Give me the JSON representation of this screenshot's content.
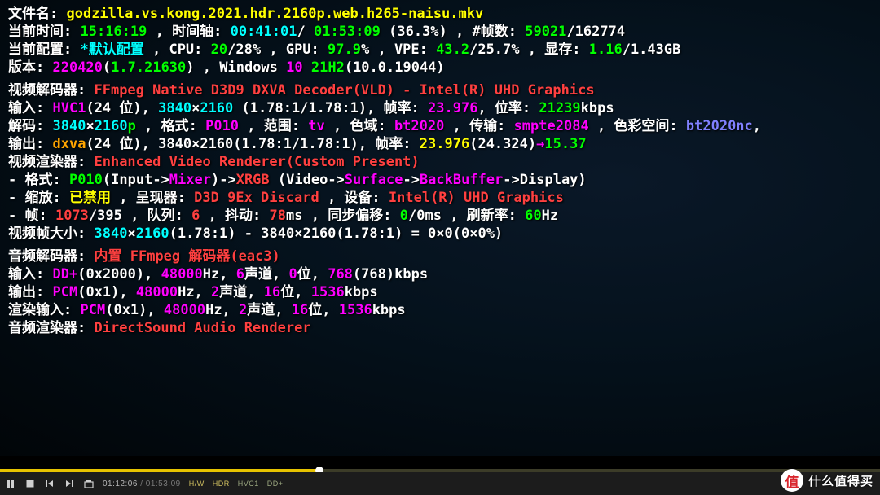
{
  "file": {
    "label": "文件名: ",
    "name": "godzilla.vs.kong.2021.hdr.2160p.web.h265-naisu.mkv"
  },
  "time": {
    "label_now": "当前时间: ",
    "now": "15:16:19",
    "sep1": ", ",
    "label_tl": "时间轴: ",
    "pos": "00:41:01",
    "dur": "01:53:09",
    "pct": "(36.3%)",
    "sep2": ", ",
    "label_frames": "#帧数: ",
    "fcur": "59021",
    "ftot": "162774"
  },
  "cfg": {
    "label": "当前配置: ",
    "name": "*默认配置",
    "cpu_l": ", CPU: ",
    "cpu_a": "20",
    "cpu_b": "28",
    "cpu_u": "%",
    "gpu_l": ", GPU: ",
    "gpu": "97.9",
    "gpu_u": "%",
    "vpe_l": ", VPE: ",
    "vpe_a": "43.2",
    "vpe_b": "25.7",
    "vpe_u": "%",
    "vram_l": ", 显存: ",
    "vram_a": "1.16",
    "vram_b": "1.43",
    "vram_u": "GB"
  },
  "ver": {
    "label": "版本: ",
    "date": "220420",
    "p1": "(",
    "v": "1.7.21630",
    "p2": ")",
    "os": ", Windows ",
    "osv": "10 ",
    "rel": "21H2",
    "p3": "(",
    "build": "10.0.19044",
    "p4": ")"
  },
  "vdec": {
    "label": "视频解码器: ",
    "name": "FFmpeg Native D3D9 DXVA Decoder(VLD) - Intel(R) UHD Graphics",
    "in_l": "输入: ",
    "in_codec": "HVC1",
    "in_p1": "(",
    "in_bits": "24 位",
    "in_p2": "), ",
    "in_w": "3840",
    "in_x": "×",
    "in_h": "2160",
    "in_ar": "(1.78:1/1.78:1)",
    "in_sep": ", ",
    "fps_l": "帧率: ",
    "fps": "23.976",
    "sep2": ", ",
    "br_l": "位率: ",
    "br": "21239",
    "br_u": "kbps",
    "dec_l": "解码: ",
    "dec_w": "3840",
    "dec_x": "×",
    "dec_h": "2160",
    "dec_p": "p",
    "fmt_l": ", 格式: ",
    "fmt": "P010",
    "rng_l": ", 范围: ",
    "rng": "tv",
    "gam_l": ", 色域: ",
    "gam": "bt2020",
    "trc_l": ", 传输: ",
    "trc": "smpte2084",
    "csp_l": ", 色彩空间: ",
    "csp": "bt2020nc",
    "csp_t": ",",
    "out_l": "输出: ",
    "out_m": "dxva",
    "out_p1": "(",
    "out_bits": "24 位",
    "out_p2": "), ",
    "out_w": "3840",
    "out_x": "×",
    "out_h": "2160",
    "out_ar": "(1.78:1/1.78:1)",
    "out_sep": ", ",
    "out_fps_l": "帧率: ",
    "out_fps": "23.976",
    "out_fp1": "(",
    "out_fps2": "24.324",
    "out_fp2": ")",
    "out_arrow": "→",
    "out_fps3": "15.37"
  },
  "rend": {
    "label": "视频渲染器: ",
    "name": "Enhanced Video Renderer(Custom Present)",
    "fmt_l": " - 格式: ",
    "p0": "P010",
    "p1": "(Input->",
    "mix": "Mixer",
    "p2": ")->",
    "xrgb": "XRGB",
    "p3": "(Video->",
    "surf": "Surface",
    "p4": "->",
    "bb": "BackBuffer",
    "p5": "->Display)",
    "scale_l": " - 缩放: ",
    "scale": "已禁用",
    "pres_l": ", 呈现器: ",
    "pres": "D3D 9Ex Discard",
    "dev_l": ", 设备: ",
    "dev": "Intel(R) UHD Graphics",
    "fr_l": " - 帧: ",
    "fr_a": "1073",
    "fr_b": "395",
    "q_l": ", 队列: ",
    "q": "6",
    "jit_l": ", 抖动: ",
    "jit": "78",
    "jit_u": "ms",
    "off_l": ", 同步偏移: ",
    "off_a": "0",
    "off_b": "0",
    "off_u": "ms",
    "rr_l": ", 刷新率: ",
    "rr": "60",
    "rr_u": "Hz",
    "fs_l": "视频帧大小: ",
    "fs_w": "3840",
    "fs_x": "×",
    "fs_h": "2160",
    "fs_ar": "(1.78:1)",
    "fs_m": " - ",
    "fs2_w": "3840",
    "fs2_x": "×",
    "fs2_h": "2160",
    "fs2_ar": "(1.78:1)",
    "fs_eq": " = ",
    "fs0": "0×0(0×0%)"
  },
  "adec": {
    "label": "音频解码器: ",
    "name": "内置 FFmpeg 解码器(eac3)",
    "in_l": "输入: ",
    "in_c": "DD+",
    "in_p1": "(",
    "in_id": "0x2000",
    "in_p2": "), ",
    "in_sr": "48000",
    "in_sr_u": "Hz, ",
    "in_ch": "6",
    "in_ch_u": "声道, ",
    "in_bd": "0",
    "in_bd_u": "位, ",
    "in_br": "768",
    "in_p3": "(",
    "in_br2": "768",
    "in_p4": ")",
    "in_bru": "kbps",
    "out_l": "输出: ",
    "out_c": "PCM",
    "out_p1": "(",
    "out_id": "0x1",
    "out_p2": "), ",
    "out_sr": "48000",
    "out_sr_u": "Hz, ",
    "out_ch": "2",
    "out_ch_u": "声道, ",
    "out_bd": "16",
    "out_bd_u": "位, ",
    "out_br": "1536",
    "out_bru": "kbps",
    "r_l": "渲染输入: ",
    "r_c": "PCM",
    "r_p1": "(",
    "r_id": "0x1",
    "r_p2": "), ",
    "r_sr": "48000",
    "r_sr_u": "Hz, ",
    "r_ch": "2",
    "r_ch_u": "声道, ",
    "r_bd": "16",
    "r_bd_u": "位, ",
    "r_br": "1536",
    "r_bru": "kbps",
    "ar_l": "音频渲染器: ",
    "ar": "DirectSound Audio Renderer"
  },
  "ctrl": {
    "pos": "01:12:06",
    "dur": "01:53:09",
    "hw": "H/W",
    "hdr": "HDR",
    "hvc1": "HVC1",
    "ddp": "DD+"
  },
  "progress": {
    "pct": 36.3
  },
  "wm": {
    "coin": "值",
    "text": "什么值得买"
  }
}
